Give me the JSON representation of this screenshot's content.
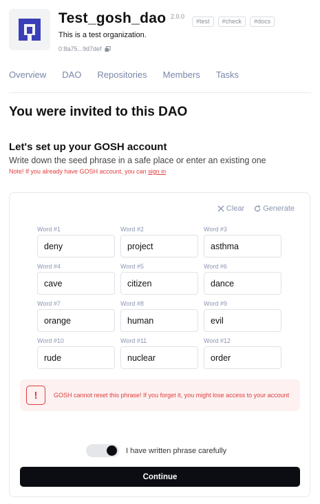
{
  "org": {
    "name": "Test_gosh_dao",
    "version": "2.0.0",
    "tags": [
      "#test",
      "#check",
      "#docs"
    ],
    "description": "This is a test organization.",
    "address": "0:8a75...9d7def"
  },
  "tabs": [
    "Overview",
    "DAO",
    "Repositories",
    "Members",
    "Tasks"
  ],
  "invite_title": "You were invited to this DAO",
  "setup": {
    "title": "Let's set up your GOSH account",
    "subtitle": "Write down the seed phrase in a safe place or enter an existing one",
    "note_prefix": "Note! If you already have GOSH account, you can ",
    "note_link": "sign in"
  },
  "phrase": {
    "clear_label": "Clear",
    "generate_label": "Generate",
    "words": [
      {
        "label": "Word #1",
        "value": "deny"
      },
      {
        "label": "Word #2",
        "value": "project"
      },
      {
        "label": "Word #3",
        "value": "asthma"
      },
      {
        "label": "Word #4",
        "value": "cave"
      },
      {
        "label": "Word #5",
        "value": "citizen"
      },
      {
        "label": "Word #6",
        "value": "dance"
      },
      {
        "label": "Word #7",
        "value": "orange"
      },
      {
        "label": "Word #8",
        "value": "human"
      },
      {
        "label": "Word #9",
        "value": "evil"
      },
      {
        "label": "Word #10",
        "value": "rude"
      },
      {
        "label": "Word #11",
        "value": "nuclear"
      },
      {
        "label": "Word #12",
        "value": "order"
      }
    ],
    "warning": "GOSH cannot reset this phrase! If you forget it, you might lose access to your account",
    "toggle_label": "I have written phrase carefully",
    "toggle_on": true,
    "continue_label": "Continue"
  },
  "colors": {
    "accent": "#3a3fb8",
    "danger": "#e03b3b",
    "button": "#0b0d12",
    "muted": "#7b86a8"
  },
  "icons": {
    "logo": "gosh-logo-icon",
    "copy": "copy-icon",
    "clear": "x-icon",
    "generate": "refresh-icon",
    "warning": "exclamation-icon"
  }
}
